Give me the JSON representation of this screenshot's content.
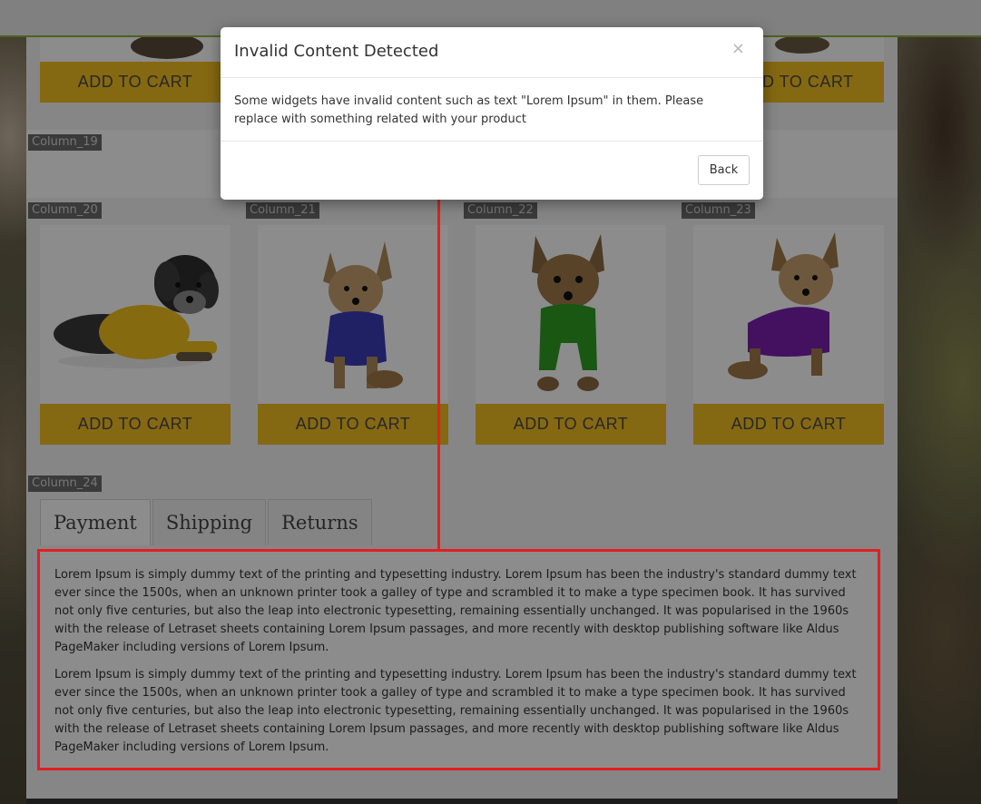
{
  "modal": {
    "title": "Invalid Content Detected",
    "close_glyph": "×",
    "message": "Some widgets have invalid content such as text \"Lorem Ipsum\" in them. Please replace with something related with your product",
    "back_label": "Back"
  },
  "columns": {
    "col19": "Column_19",
    "col20": "Column_20",
    "col21": "Column_21",
    "col22": "Column_22",
    "col23": "Column_23",
    "col24": "Column_24"
  },
  "top_row": {
    "cart_left": "ADD TO CART",
    "cart_right": "D TO CART"
  },
  "products": [
    {
      "sweater_color": "#f2c21c",
      "cart_label": "ADD TO CART",
      "icon": "dog-yellow-sweater"
    },
    {
      "sweater_color": "#3b3bb8",
      "cart_label": "ADD TO CART",
      "icon": "dog-blue-polo"
    },
    {
      "sweater_color": "#2f9e22",
      "cart_label": "ADD TO CART",
      "icon": "dog-green-sweater"
    },
    {
      "sweater_color": "#7a1fb0",
      "cart_label": "ADD TO CART",
      "icon": "dog-purple-sweater"
    }
  ],
  "tabs": [
    "Payment",
    "Shipping",
    "Returns"
  ],
  "tab_content": {
    "paragraph_1": "Lorem Ipsum is simply dummy text of the printing and typesetting industry. Lorem Ipsum has been the industry's standard dummy text ever since the 1500s, when an unknown printer took a galley of type and scrambled it to make a type specimen book. It has survived not only five centuries, but also the leap into electronic typesetting, remaining essentially unchanged. It was popularised in the 1960s with the release of Letraset sheets containing Lorem Ipsum passages, and more recently with desktop publishing software like Aldus PageMaker including versions of Lorem Ipsum.",
    "paragraph_2": "Lorem Ipsum is simply dummy text of the printing and typesetting industry. Lorem Ipsum has been the industry's standard dummy text ever since the 1500s, when an unknown printer took a galley of type and scrambled it to make a type specimen book. It has survived not only five centuries, but also the leap into electronic typesetting, remaining essentially unchanged. It was popularised in the 1960s with the release of Letraset sheets containing Lorem Ipsum passages, and more recently with desktop publishing software like Aldus PageMaker including versions of Lorem Ipsum."
  },
  "colors": {
    "cart_button": "#f2be22",
    "highlight_border": "#e02020",
    "top_bar_accent": "#8ab33a"
  }
}
